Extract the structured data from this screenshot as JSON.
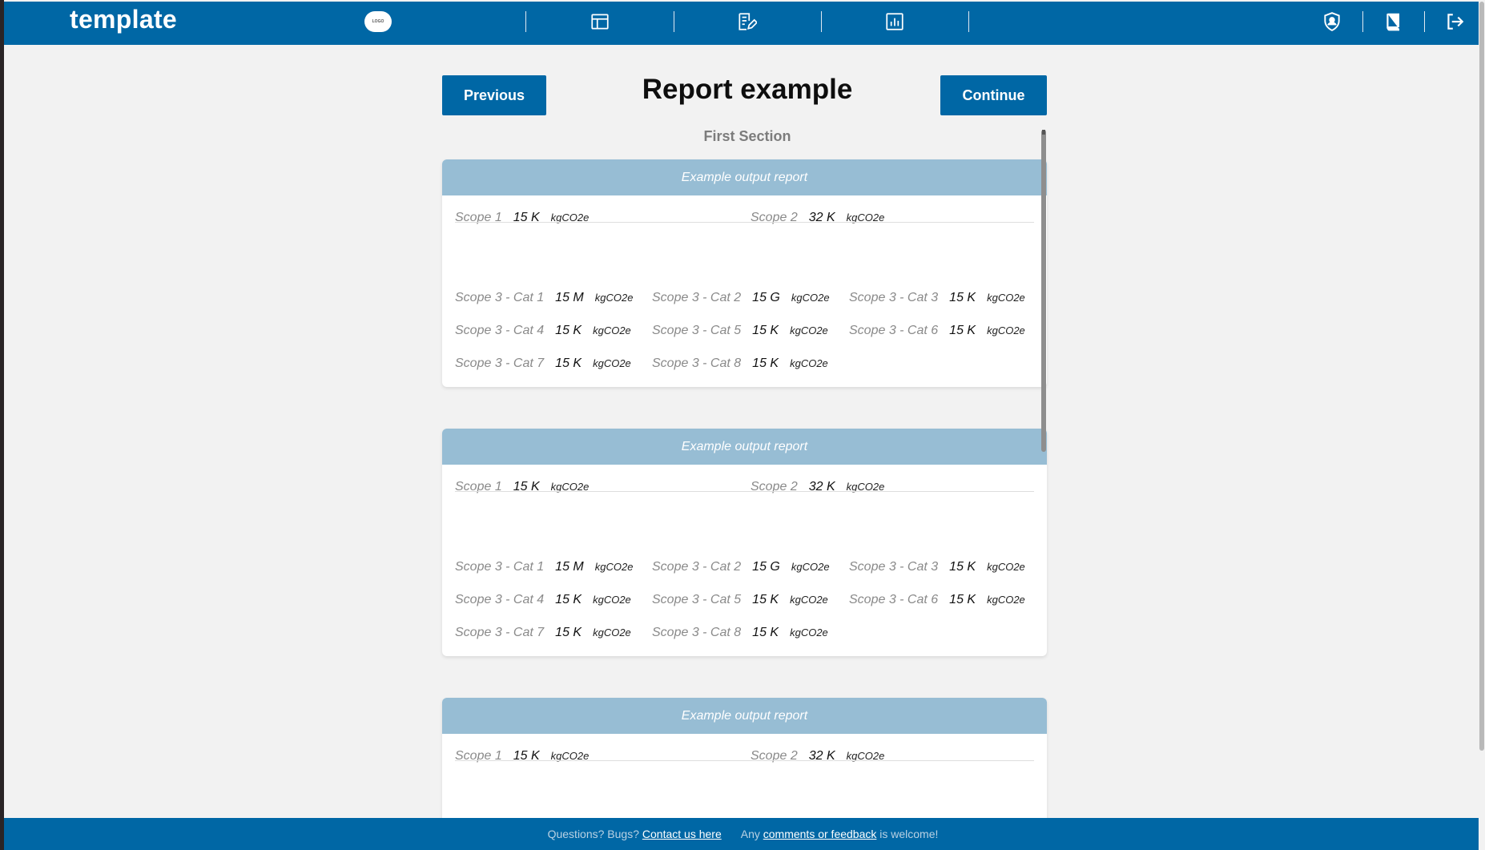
{
  "header": {
    "brand": "template",
    "logo_text": "LOGO",
    "nav_icons": [
      "layout-icon",
      "edit-document-icon",
      "bar-chart-icon"
    ],
    "right_icons": [
      "shield-user-icon",
      "book-icon",
      "logout-icon"
    ]
  },
  "toolbar": {
    "previous_label": "Previous",
    "continue_label": "Continue",
    "page_title": "Report example",
    "section_title": "First Section"
  },
  "cards": [
    {
      "title": "Example output report",
      "scopes": [
        {
          "label": "Scope 1",
          "value": "15 K",
          "unit": "kgCO2e"
        },
        {
          "label": "Scope 2",
          "value": "32 K",
          "unit": "kgCO2e"
        }
      ],
      "categories": [
        {
          "label": "Scope 3 - Cat 1",
          "value": "15 M",
          "unit": "kgCO2e"
        },
        {
          "label": "Scope 3 - Cat 2",
          "value": "15 G",
          "unit": "kgCO2e"
        },
        {
          "label": "Scope 3 - Cat 3",
          "value": "15 K",
          "unit": "kgCO2e"
        },
        {
          "label": "Scope 3 - Cat 4",
          "value": "15 K",
          "unit": "kgCO2e"
        },
        {
          "label": "Scope 3 - Cat 5",
          "value": "15 K",
          "unit": "kgCO2e"
        },
        {
          "label": "Scope 3 - Cat 6",
          "value": "15 K",
          "unit": "kgCO2e"
        },
        {
          "label": "Scope 3 - Cat 7",
          "value": "15 K",
          "unit": "kgCO2e"
        },
        {
          "label": "Scope 3 - Cat 8",
          "value": "15 K",
          "unit": "kgCO2e"
        }
      ]
    },
    {
      "title": "Example output report",
      "scopes": [
        {
          "label": "Scope 1",
          "value": "15 K",
          "unit": "kgCO2e"
        },
        {
          "label": "Scope 2",
          "value": "32 K",
          "unit": "kgCO2e"
        }
      ],
      "categories": [
        {
          "label": "Scope 3 - Cat 1",
          "value": "15 M",
          "unit": "kgCO2e"
        },
        {
          "label": "Scope 3 - Cat 2",
          "value": "15 G",
          "unit": "kgCO2e"
        },
        {
          "label": "Scope 3 - Cat 3",
          "value": "15 K",
          "unit": "kgCO2e"
        },
        {
          "label": "Scope 3 - Cat 4",
          "value": "15 K",
          "unit": "kgCO2e"
        },
        {
          "label": "Scope 3 - Cat 5",
          "value": "15 K",
          "unit": "kgCO2e"
        },
        {
          "label": "Scope 3 - Cat 6",
          "value": "15 K",
          "unit": "kgCO2e"
        },
        {
          "label": "Scope 3 - Cat 7",
          "value": "15 K",
          "unit": "kgCO2e"
        },
        {
          "label": "Scope 3 - Cat 8",
          "value": "15 K",
          "unit": "kgCO2e"
        }
      ]
    },
    {
      "title": "Example output report",
      "scopes": [
        {
          "label": "Scope 1",
          "value": "15 K",
          "unit": "kgCO2e"
        },
        {
          "label": "Scope 2",
          "value": "32 K",
          "unit": "kgCO2e"
        }
      ],
      "categories": []
    }
  ],
  "footer": {
    "questions_text": "Questions? Bugs?",
    "contact_link": "Contact us here",
    "any_text": "Any",
    "feedback_link": "comments or feedback",
    "welcome_text": "is welcome!"
  },
  "colors": {
    "primary": "#0067a5",
    "card_header": "#97bdd4",
    "background": "#f2f2f2"
  }
}
